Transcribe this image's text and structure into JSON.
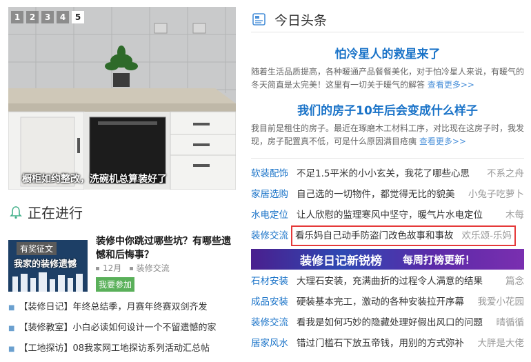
{
  "slider": {
    "pages": [
      "1",
      "2",
      "3",
      "4",
      "5"
    ],
    "active_page": "5",
    "caption": "橱柜如约整改，洗碗机总算装好了"
  },
  "ongoing": {
    "title": "正在进行",
    "feature": {
      "thumb_tag": "有奖征文",
      "thumb_text": "我家的装修遗憾",
      "title": "装修中你跳过哪些坑？有哪些遗憾和后悔事？",
      "month": "12月",
      "category": "装修交流",
      "join_label": "我要参加"
    },
    "items": [
      "【装修日记】年终总结季，月赛年终赛双剑齐发",
      "【装修教室】小白必读如何设计一个不留遗憾的家",
      "【工地探访】08我家网工地探访系列活动汇总帖"
    ]
  },
  "headlines": {
    "title": "今日头条",
    "stories": [
      {
        "title": "怕冷星人的救星来了",
        "desc": "随着生活品质提高，各种暖通产品餐餐美化，对于怕冷星人来说，有暖气的冬天简直是太完美！这里有一切关于暖气的解答",
        "more": "查看更多>>"
      },
      {
        "title": "我们的房子10年后会变成什么样子",
        "desc": "我目前是租住的房子。最近在琢磨木工材料工序，对比现在这房子时，我发现，房子配置真不低，可是什么原因满目疮痍",
        "more": "查看更多>>"
      }
    ],
    "rows": [
      {
        "cat": "软装配饰",
        "title": "不足1.5平米的小小玄关，我花了哪些心思",
        "author": "不系之舟"
      },
      {
        "cat": "家居选购",
        "title": "自己选的一切物件，都觉得无比的貌美",
        "author": "小兔子吃萝卜"
      },
      {
        "cat": "水电定位",
        "title": "让人欣慰的监理寒风中坚守，暖气片水电定位",
        "author": "木每"
      },
      {
        "cat": "装修交流",
        "title": "看乐妈自己动手防盗门改色故事和事故",
        "author": "欢乐颂-乐妈"
      }
    ],
    "banner": {
      "main": "装修日记新锐榜",
      "sub": "每周打榜更新！"
    },
    "rows2": [
      {
        "cat": "石材安装",
        "title": "大理石安装，充满曲折的过程令人满意的结果",
        "author": "篇念"
      },
      {
        "cat": "成品安装",
        "title": "硬装基本完工，激动的各种安装拉开序幕",
        "author": "我爱小花园"
      },
      {
        "cat": "装修交流",
        "title": "看我是如何巧妙的隐藏处理好假出风口的问题",
        "author": "晴循循"
      },
      {
        "cat": "居家风水",
        "title": "错过门槛石下放五帝钱，用别的方式弥补",
        "author": "大胖是大佬"
      }
    ]
  },
  "colors": {
    "link_blue": "#1a73c8",
    "highlight_red": "#e53939",
    "join_green": "#5ab05a"
  }
}
